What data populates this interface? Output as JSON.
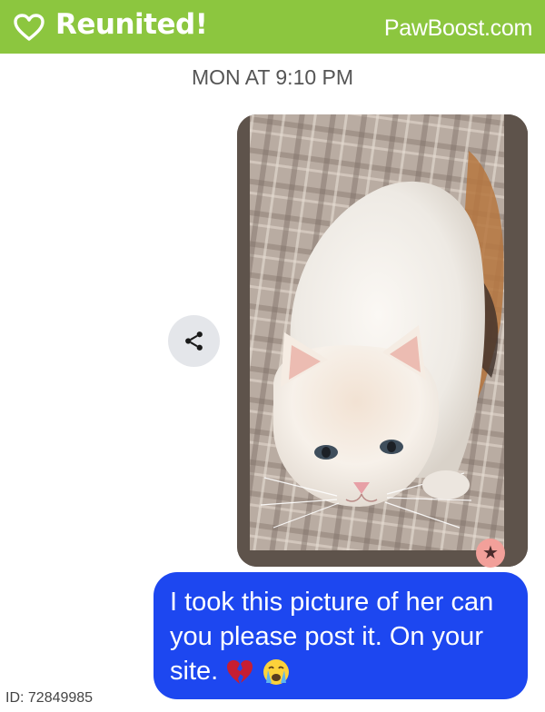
{
  "banner": {
    "status": "Reunited!",
    "brand": "PawBoost.com",
    "color": "#8cc63f",
    "icon": "heart-outline-icon"
  },
  "conversation": {
    "timestamp": "MON AT 9:10 PM",
    "photo": {
      "subject": "white and cream cat on plaid blanket"
    },
    "share_icon": "share-icon",
    "reaction_icon": "star-icon",
    "message": {
      "text": "I took this picture of her can you please post it. On your site.",
      "emojis": [
        "broken-heart-emoji",
        "crying-face-emoji"
      ],
      "bubble_color": "#1d47f0"
    }
  },
  "footer": {
    "pet_id": "ID: 72849985"
  }
}
